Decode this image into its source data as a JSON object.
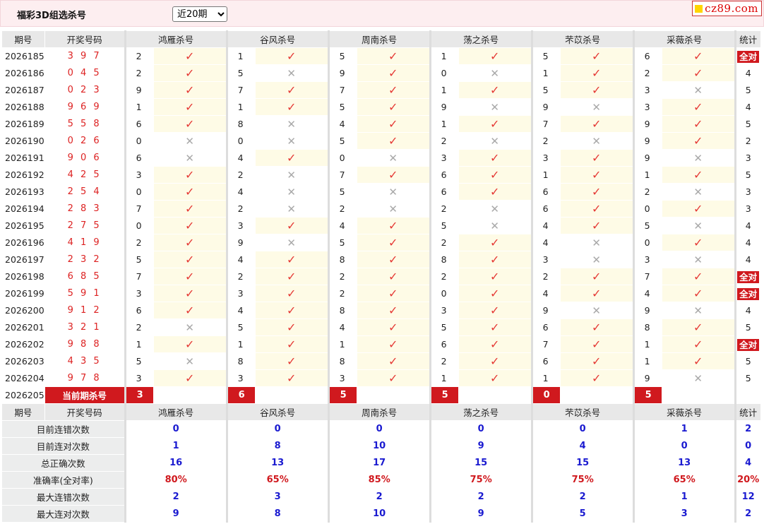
{
  "header": {
    "title": "福彩3D组选杀号",
    "period_selected": "近20期",
    "period_options": [
      "近20期"
    ],
    "logo_text": "cz89.com"
  },
  "columns": {
    "issue": "期号",
    "draw": "开奖号码",
    "experts": [
      "鸿雁杀号",
      "谷风杀号",
      "周南杀号",
      "荡之杀号",
      "芣苡杀号",
      "采薇杀号"
    ],
    "stat": "统计"
  },
  "rows": [
    {
      "issue": "2026185",
      "draw": "3 9 7",
      "kills": [
        "2",
        "1",
        "5",
        "1",
        "5",
        "6"
      ],
      "results": [
        1,
        1,
        1,
        1,
        1,
        1
      ],
      "stat": "全对"
    },
    {
      "issue": "2026186",
      "draw": "0 4 5",
      "kills": [
        "2",
        "5",
        "9",
        "0",
        "1",
        "2"
      ],
      "results": [
        1,
        0,
        1,
        0,
        1,
        1
      ],
      "stat": "4"
    },
    {
      "issue": "2026187",
      "draw": "0 2 3",
      "kills": [
        "9",
        "7",
        "7",
        "1",
        "5",
        "3"
      ],
      "results": [
        1,
        1,
        1,
        1,
        1,
        0
      ],
      "stat": "5"
    },
    {
      "issue": "2026188",
      "draw": "9 6 9",
      "kills": [
        "1",
        "1",
        "5",
        "9",
        "9",
        "3"
      ],
      "results": [
        1,
        1,
        1,
        0,
        0,
        1
      ],
      "stat": "4"
    },
    {
      "issue": "2026189",
      "draw": "5 5 8",
      "kills": [
        "6",
        "8",
        "4",
        "1",
        "7",
        "9"
      ],
      "results": [
        1,
        0,
        1,
        1,
        1,
        1
      ],
      "stat": "5"
    },
    {
      "issue": "2026190",
      "draw": "0 2 6",
      "kills": [
        "0",
        "0",
        "5",
        "2",
        "2",
        "9"
      ],
      "results": [
        0,
        0,
        1,
        0,
        0,
        1
      ],
      "stat": "2"
    },
    {
      "issue": "2026191",
      "draw": "9 0 6",
      "kills": [
        "6",
        "4",
        "0",
        "3",
        "3",
        "9"
      ],
      "results": [
        0,
        1,
        0,
        1,
        1,
        0
      ],
      "stat": "3"
    },
    {
      "issue": "2026192",
      "draw": "4 2 5",
      "kills": [
        "3",
        "2",
        "7",
        "6",
        "1",
        "1"
      ],
      "results": [
        1,
        0,
        1,
        1,
        1,
        1
      ],
      "stat": "5"
    },
    {
      "issue": "2026193",
      "draw": "2 5 4",
      "kills": [
        "0",
        "4",
        "5",
        "6",
        "6",
        "2"
      ],
      "results": [
        1,
        0,
        0,
        1,
        1,
        0
      ],
      "stat": "3"
    },
    {
      "issue": "2026194",
      "draw": "2 8 3",
      "kills": [
        "7",
        "2",
        "2",
        "2",
        "6",
        "0"
      ],
      "results": [
        1,
        0,
        0,
        0,
        1,
        1
      ],
      "stat": "3"
    },
    {
      "issue": "2026195",
      "draw": "2 7 5",
      "kills": [
        "0",
        "3",
        "4",
        "5",
        "4",
        "5"
      ],
      "results": [
        1,
        1,
        1,
        0,
        1,
        0
      ],
      "stat": "4"
    },
    {
      "issue": "2026196",
      "draw": "4 1 9",
      "kills": [
        "2",
        "9",
        "5",
        "2",
        "4",
        "0"
      ],
      "results": [
        1,
        0,
        1,
        1,
        0,
        1
      ],
      "stat": "4"
    },
    {
      "issue": "2026197",
      "draw": "2 3 2",
      "kills": [
        "5",
        "4",
        "8",
        "8",
        "3",
        "3"
      ],
      "results": [
        1,
        1,
        1,
        1,
        0,
        0
      ],
      "stat": "4"
    },
    {
      "issue": "2026198",
      "draw": "6 8 5",
      "kills": [
        "7",
        "2",
        "2",
        "2",
        "2",
        "7"
      ],
      "results": [
        1,
        1,
        1,
        1,
        1,
        1
      ],
      "stat": "全对"
    },
    {
      "issue": "2026199",
      "draw": "5 9 1",
      "kills": [
        "3",
        "3",
        "2",
        "0",
        "4",
        "4"
      ],
      "results": [
        1,
        1,
        1,
        1,
        1,
        1
      ],
      "stat": "全对"
    },
    {
      "issue": "2026200",
      "draw": "9 1 2",
      "kills": [
        "6",
        "4",
        "8",
        "3",
        "9",
        "9"
      ],
      "results": [
        1,
        1,
        1,
        1,
        0,
        0
      ],
      "stat": "4"
    },
    {
      "issue": "2026201",
      "draw": "3 2 1",
      "kills": [
        "2",
        "5",
        "4",
        "5",
        "6",
        "8"
      ],
      "results": [
        0,
        1,
        1,
        1,
        1,
        1
      ],
      "stat": "5"
    },
    {
      "issue": "2026202",
      "draw": "9 8 8",
      "kills": [
        "1",
        "1",
        "1",
        "6",
        "7",
        "1"
      ],
      "results": [
        1,
        1,
        1,
        1,
        1,
        1
      ],
      "stat": "全对"
    },
    {
      "issue": "2026203",
      "draw": "4 3 5",
      "kills": [
        "5",
        "8",
        "8",
        "2",
        "6",
        "1"
      ],
      "results": [
        0,
        1,
        1,
        1,
        1,
        1
      ],
      "stat": "5"
    },
    {
      "issue": "2026204",
      "draw": "9 7 8",
      "kills": [
        "3",
        "3",
        "3",
        "1",
        "1",
        "9"
      ],
      "results": [
        1,
        1,
        1,
        1,
        1,
        0
      ],
      "stat": "5"
    }
  ],
  "current": {
    "issue": "2026205",
    "label": "当前期杀号",
    "kills": [
      "3",
      "6",
      "5",
      "5",
      "0",
      "5"
    ]
  },
  "summary": [
    {
      "label": "目前连错次数",
      "values": [
        "0",
        "0",
        "0",
        "0",
        "0",
        "1"
      ],
      "stat": "2",
      "pct": false
    },
    {
      "label": "目前连对次数",
      "values": [
        "1",
        "8",
        "10",
        "9",
        "4",
        "0"
      ],
      "stat": "0",
      "pct": false
    },
    {
      "label": "总正确次数",
      "values": [
        "16",
        "13",
        "17",
        "15",
        "15",
        "13"
      ],
      "stat": "4",
      "pct": false
    },
    {
      "label": "准确率(全对率)",
      "values": [
        "80%",
        "65%",
        "85%",
        "75%",
        "75%",
        "65%"
      ],
      "stat": "20%",
      "pct": true
    },
    {
      "label": "最大连错次数",
      "values": [
        "2",
        "3",
        "2",
        "2",
        "2",
        "1"
      ],
      "stat": "12",
      "pct": false
    },
    {
      "label": "最大连对次数",
      "values": [
        "9",
        "8",
        "10",
        "9",
        "5",
        "3"
      ],
      "stat": "2",
      "pct": false
    }
  ],
  "icons": {
    "correct": "check-icon",
    "wrong": "cross-icon"
  },
  "colors": {
    "accent": "#d0191e",
    "check": "#e53935",
    "cross": "#a9a9a9",
    "summary_value": "#1a1ad0",
    "header_bg": "#fdeef0"
  }
}
